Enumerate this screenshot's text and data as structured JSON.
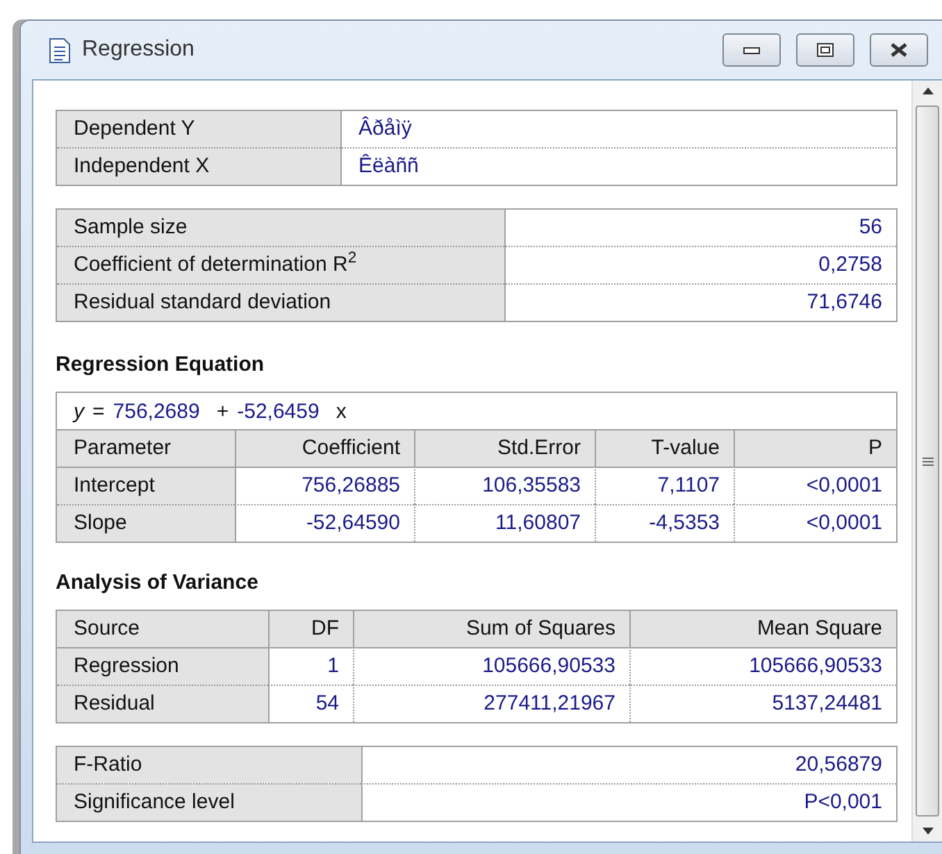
{
  "window": {
    "title": "Regression"
  },
  "variables": [
    {
      "label": "Dependent Y",
      "value": "Âðåìÿ"
    },
    {
      "label": "Independent X",
      "value": "Êëàññ"
    }
  ],
  "summary": [
    {
      "label": "Sample size",
      "value": "56"
    },
    {
      "label": "Coefficient of determination R$^{2}$",
      "value": "0,2758"
    },
    {
      "label": "Residual standard deviation",
      "value": "71,6746"
    }
  ],
  "regression_equation": {
    "heading": "Regression Equation",
    "equation": [
      {
        "kind": "variable",
        "text": "y"
      },
      {
        "kind": "operator",
        "text": "="
      },
      {
        "kind": "number",
        "text": "756,2689"
      },
      {
        "kind": "operator",
        "text": "+"
      },
      {
        "kind": "number",
        "text": "-52,6459"
      },
      {
        "kind": "operator",
        "text": "x"
      }
    ],
    "columns": [
      "Parameter",
      "Coefficient",
      "Std.Error",
      "T-value",
      "P"
    ],
    "rows": [
      [
        "Intercept",
        "756,26885",
        "106,35583",
        "7,1107",
        "<0,0001"
      ],
      [
        "Slope",
        "-52,64590",
        "11,60807",
        "-4,5353",
        "<0,0001"
      ]
    ]
  },
  "analysis_of_variance": {
    "heading": "Analysis of Variance",
    "columns": [
      "Source",
      "DF",
      "Sum of Squares",
      "Mean Square"
    ],
    "rows": [
      [
        "Regression",
        "1",
        "105666,90533",
        "105666,90533"
      ],
      [
        "Residual",
        "54",
        "277411,21967",
        "5137,24481"
      ]
    ]
  },
  "tests": [
    {
      "label": "F-Ratio",
      "value": "20,56879"
    },
    {
      "label": "Significance level",
      "value": "P<0,001"
    }
  ]
}
